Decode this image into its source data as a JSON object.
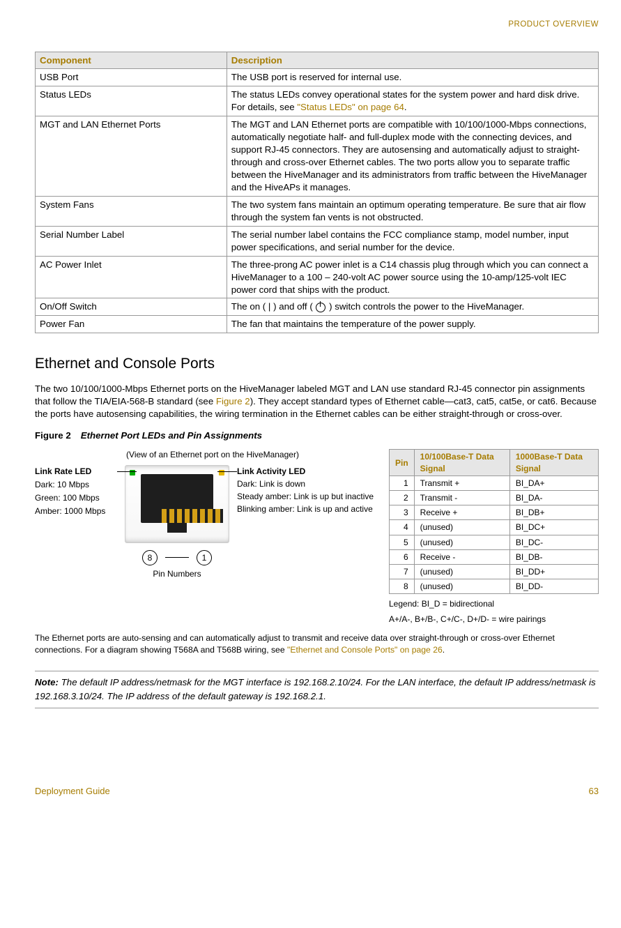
{
  "page": {
    "running_head": "PRODUCT OVERVIEW",
    "footer_left": "Deployment Guide",
    "footer_right": "63"
  },
  "components_table": {
    "headers": [
      "Component",
      "Description"
    ],
    "rows": [
      {
        "component": "USB Port",
        "desc": "The USB port is reserved for internal use."
      },
      {
        "component": "Status LEDs",
        "desc_pre": "The status LEDs convey operational states for the system power and hard disk drive. For details, see ",
        "link": "\"Status LEDs\" on page 64",
        "desc_post": "."
      },
      {
        "component": "MGT and LAN Ethernet Ports",
        "desc": "The MGT and LAN Ethernet ports are compatible with 10/100/1000-Mbps connections, automatically negotiate half- and full-duplex mode with the connecting devices, and support RJ-45 connectors. They are autosensing and automatically adjust to straight-through and cross-over Ethernet cables. The two ports allow you to separate traffic between the HiveManager and its administrators from traffic between the HiveManager and the HiveAPs it manages."
      },
      {
        "component": "System Fans",
        "desc": "The two system fans maintain an optimum operating temperature. Be sure that air flow through the system fan vents is not obstructed."
      },
      {
        "component": "Serial Number Label",
        "desc": "The serial number label contains the FCC compliance stamp, model number, input power specifications, and serial number for the device."
      },
      {
        "component": "AC Power Inlet",
        "desc": "The three-prong AC power inlet is a C14 chassis plug through which you can connect a HiveManager to a 100 – 240-volt AC power source using the 10-amp/125-volt IEC power cord that ships with the product."
      },
      {
        "component": "On/Off Switch",
        "desc_pre": "The on ( | ) and off ( ",
        "desc_post": " ) switch controls the power to the HiveManager."
      },
      {
        "component": "Power Fan",
        "desc": "The fan that maintains the temperature of the power supply."
      }
    ]
  },
  "section": {
    "title": "Ethernet and Console Ports",
    "para_pre": "The two 10/100/1000-Mbps Ethernet ports on the HiveManager labeled MGT and LAN use standard RJ-45 connector pin assignments that follow the TIA/EIA-568-B standard (see ",
    "link": "Figure 2",
    "para_post": "). They accept standard types of Ethernet cable—cat3, cat5, cat5e, or cat6. Because the ports have autosensing capabilities, the wiring termination in the Ethernet cables can be either straight-through or cross-over."
  },
  "figure": {
    "number": "Figure 2",
    "caption": "Ethernet Port LEDs and Pin Assignments",
    "view_label": "(View of an Ethernet port on the HiveManager)",
    "link_rate": {
      "title": "Link Rate LED",
      "l1": "Dark: 10 Mbps",
      "l2": "Green: 100 Mbps",
      "l3": "Amber: 1000 Mbps"
    },
    "link_act": {
      "title": "Link Activity LED",
      "l1": "Dark: Link is down",
      "l2": "Steady amber: Link is up but inactive",
      "l3": "Blinking amber: Link is up and active"
    },
    "pin_left": "8",
    "pin_right": "1",
    "pin_numbers_label": "Pin Numbers"
  },
  "pin_table": {
    "headers": {
      "pin": "Pin",
      "col1": "10/100Base-T Data Signal",
      "col2": "1000Base-T Data Signal"
    },
    "rows": [
      {
        "pin": "1",
        "a": "Transmit +",
        "b": "BI_DA+"
      },
      {
        "pin": "2",
        "a": "Transmit -",
        "b": "BI_DA-"
      },
      {
        "pin": "3",
        "a": "Receive +",
        "b": "BI_DB+"
      },
      {
        "pin": "4",
        "a": "(unused)",
        "b": "BI_DC+"
      },
      {
        "pin": "5",
        "a": "(unused)",
        "b": "BI_DC-"
      },
      {
        "pin": "6",
        "a": "Receive -",
        "b": "BI_DB-"
      },
      {
        "pin": "7",
        "a": "(unused)",
        "b": "BI_DD+"
      },
      {
        "pin": "8",
        "a": "(unused)",
        "b": "BI_DD-"
      }
    ],
    "legend1": "Legend: BI_D = bidirectional",
    "legend2": "A+/A-, B+/B-, C+/C-, D+/D- = wire pairings"
  },
  "under_note_pre": "The Ethernet ports are auto-sensing and can automatically adjust to transmit and receive data over straight-through or cross-over Ethernet connections. For a diagram showing T568A and T568B wiring, see ",
  "under_note_link": "\"Ethernet and Console Ports\" on page 26",
  "under_note_post": ".",
  "note": {
    "label": "Note:",
    "text": "The default IP address/netmask for the MGT interface is 192.168.2.10/24. For the LAN interface, the default IP address/netmask is 192.168.3.10/24. The IP address of the default gateway is 192.168.2.1."
  }
}
